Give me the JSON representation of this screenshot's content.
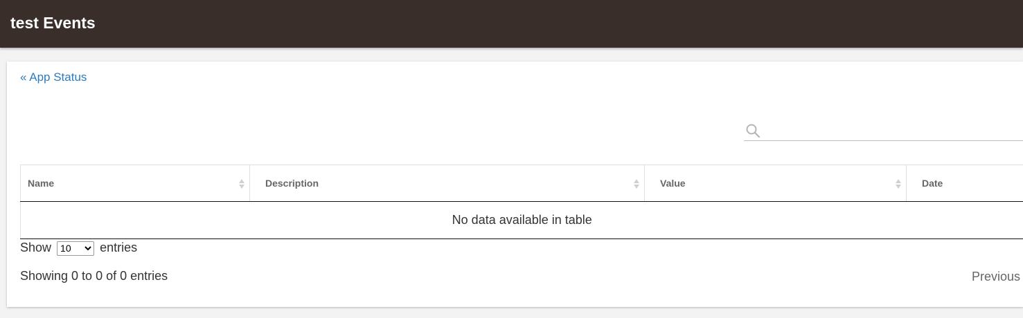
{
  "header": {
    "title": "test Events"
  },
  "nav": {
    "back_link": "« App Status"
  },
  "search": {
    "placeholder": "",
    "value": ""
  },
  "table": {
    "columns": [
      "Name",
      "Description",
      "Value",
      "Date"
    ],
    "empty_message": "No data available in table"
  },
  "length": {
    "prefix": "Show",
    "selected": "10",
    "options": [
      "10"
    ],
    "suffix": "entries"
  },
  "footer": {
    "info": "Showing 0 to 0 of 0 entries",
    "previous_label": "Previous"
  },
  "colors": {
    "header_bg": "#3a2e2b",
    "link": "#2c7bbd"
  },
  "icons": {
    "search": "search-icon",
    "sort": "sort-icon"
  }
}
